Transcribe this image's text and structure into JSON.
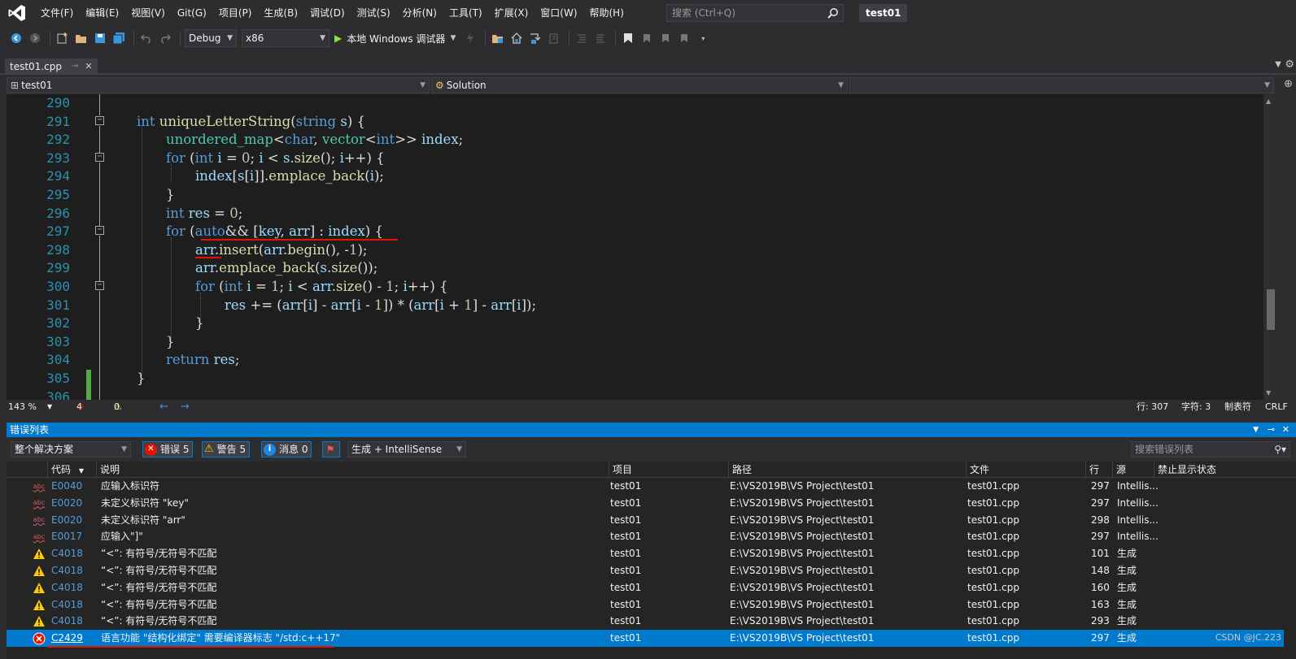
{
  "menubar": {
    "items": [
      "文件(F)",
      "编辑(E)",
      "视图(V)",
      "Git(G)",
      "项目(P)",
      "生成(B)",
      "调试(D)",
      "测试(S)",
      "分析(N)",
      "工具(T)",
      "扩展(X)",
      "窗口(W)",
      "帮助(H)"
    ],
    "search_placeholder": "搜索 (Ctrl+Q)",
    "solution_title": "test01"
  },
  "toolbar": {
    "config": "Debug",
    "platform": "x86",
    "run_label": "本地 Windows 调试器"
  },
  "tab": {
    "filename": "test01.cpp"
  },
  "navbar": {
    "project": "test01",
    "scope": "Solution",
    "member": ""
  },
  "editor": {
    "line_numbers": [
      "290",
      "291",
      "292",
      "293",
      "294",
      "295",
      "296",
      "297",
      "298",
      "299",
      "300",
      "301",
      "302",
      "303",
      "304",
      "305",
      "306"
    ]
  },
  "edstatus": {
    "zoom": "143 %",
    "errors": "4",
    "warnings": "0",
    "line": "行: 307",
    "char": "字符: 3",
    "tabs": "制表符",
    "eol": "CRLF"
  },
  "errorlist": {
    "title": "错误列表",
    "scope": "整个解决方案",
    "errors_btn": "错误 5",
    "warnings_btn": "警告 5",
    "messages_btn": "消息 0",
    "build_filter": "生成 + IntelliSense",
    "search_placeholder": "搜索错误列表",
    "columns": {
      "code": "代码",
      "desc": "说明",
      "project": "项目",
      "path": "路径",
      "file": "文件",
      "line": "行",
      "source": "源",
      "suppress": "禁止显示状态"
    },
    "rows": [
      {
        "kind": "abc",
        "code": "E0040",
        "desc": "应输入标识符",
        "project": "test01",
        "path": "E:\\VS2019B\\VS Project\\test01",
        "file": "test01.cpp",
        "line": "297",
        "source": "Intellis..."
      },
      {
        "kind": "abc",
        "code": "E0020",
        "desc": "未定义标识符 \"key\"",
        "project": "test01",
        "path": "E:\\VS2019B\\VS Project\\test01",
        "file": "test01.cpp",
        "line": "297",
        "source": "Intellis..."
      },
      {
        "kind": "abc",
        "code": "E0020",
        "desc": "未定义标识符 \"arr\"",
        "project": "test01",
        "path": "E:\\VS2019B\\VS Project\\test01",
        "file": "test01.cpp",
        "line": "298",
        "source": "Intellis..."
      },
      {
        "kind": "abc",
        "code": "E0017",
        "desc": "应输入\"]\"",
        "project": "test01",
        "path": "E:\\VS2019B\\VS Project\\test01",
        "file": "test01.cpp",
        "line": "297",
        "source": "Intellis..."
      },
      {
        "kind": "warn",
        "code": "C4018",
        "desc": "“<”: 有符号/无符号不匹配",
        "project": "test01",
        "path": "E:\\VS2019B\\VS Project\\test01",
        "file": "test01.cpp",
        "line": "101",
        "source": "生成"
      },
      {
        "kind": "warn",
        "code": "C4018",
        "desc": "“<”: 有符号/无符号不匹配",
        "project": "test01",
        "path": "E:\\VS2019B\\VS Project\\test01",
        "file": "test01.cpp",
        "line": "148",
        "source": "生成"
      },
      {
        "kind": "warn",
        "code": "C4018",
        "desc": "“<”: 有符号/无符号不匹配",
        "project": "test01",
        "path": "E:\\VS2019B\\VS Project\\test01",
        "file": "test01.cpp",
        "line": "160",
        "source": "生成"
      },
      {
        "kind": "warn",
        "code": "C4018",
        "desc": "“<”: 有符号/无符号不匹配",
        "project": "test01",
        "path": "E:\\VS2019B\\VS Project\\test01",
        "file": "test01.cpp",
        "line": "163",
        "source": "生成"
      },
      {
        "kind": "warn",
        "code": "C4018",
        "desc": "“<”: 有符号/无符号不匹配",
        "project": "test01",
        "path": "E:\\VS2019B\\VS Project\\test01",
        "file": "test01.cpp",
        "line": "293",
        "source": "生成"
      },
      {
        "kind": "error",
        "code": "C2429",
        "desc": "语言功能 \"结构化绑定\" 需要编译器标志 \"/std:c++17\"",
        "project": "test01",
        "path": "E:\\VS2019B\\VS Project\\test01",
        "file": "test01.cpp",
        "line": "297",
        "source": "生成"
      }
    ]
  },
  "watermark": "CSDN @JC.223"
}
